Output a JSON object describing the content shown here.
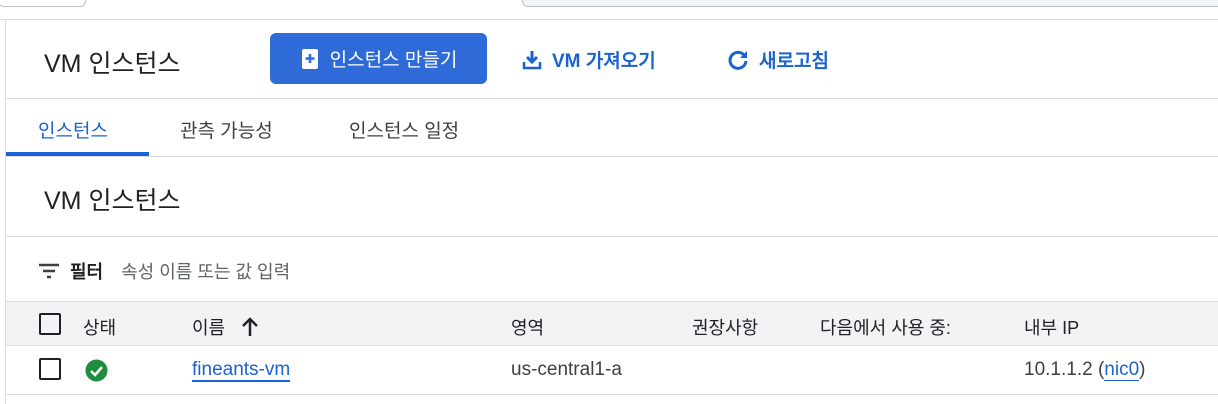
{
  "header": {
    "title": "VM 인스턴스",
    "create_label": "인스턴스 만들기",
    "import_label": "VM 가져오기",
    "refresh_label": "새로고침"
  },
  "tabs": [
    {
      "label": "인스턴스",
      "active": true
    },
    {
      "label": "관측 가능성"
    },
    {
      "label": "인스턴스 일정"
    }
  ],
  "section_title": "VM 인스턴스",
  "filter": {
    "label": "필터",
    "placeholder": "속성 이름 또는 값 입력"
  },
  "table": {
    "columns": [
      "상태",
      "이름",
      "영역",
      "권장사항",
      "다음에서 사용 중:",
      "내부 IP"
    ],
    "sort_icon": "arrow-up-icon",
    "rows": [
      {
        "status": "running",
        "name": "fineants-vm",
        "zone": "us-central1-a",
        "recommendation": "",
        "in_use_by": "",
        "internal_ip": "10.1.1.2",
        "nic": "nic0"
      }
    ]
  },
  "colors": {
    "accent": "#1a62d1",
    "button": "#2f6bd8",
    "ok": "#1e8e3e"
  }
}
